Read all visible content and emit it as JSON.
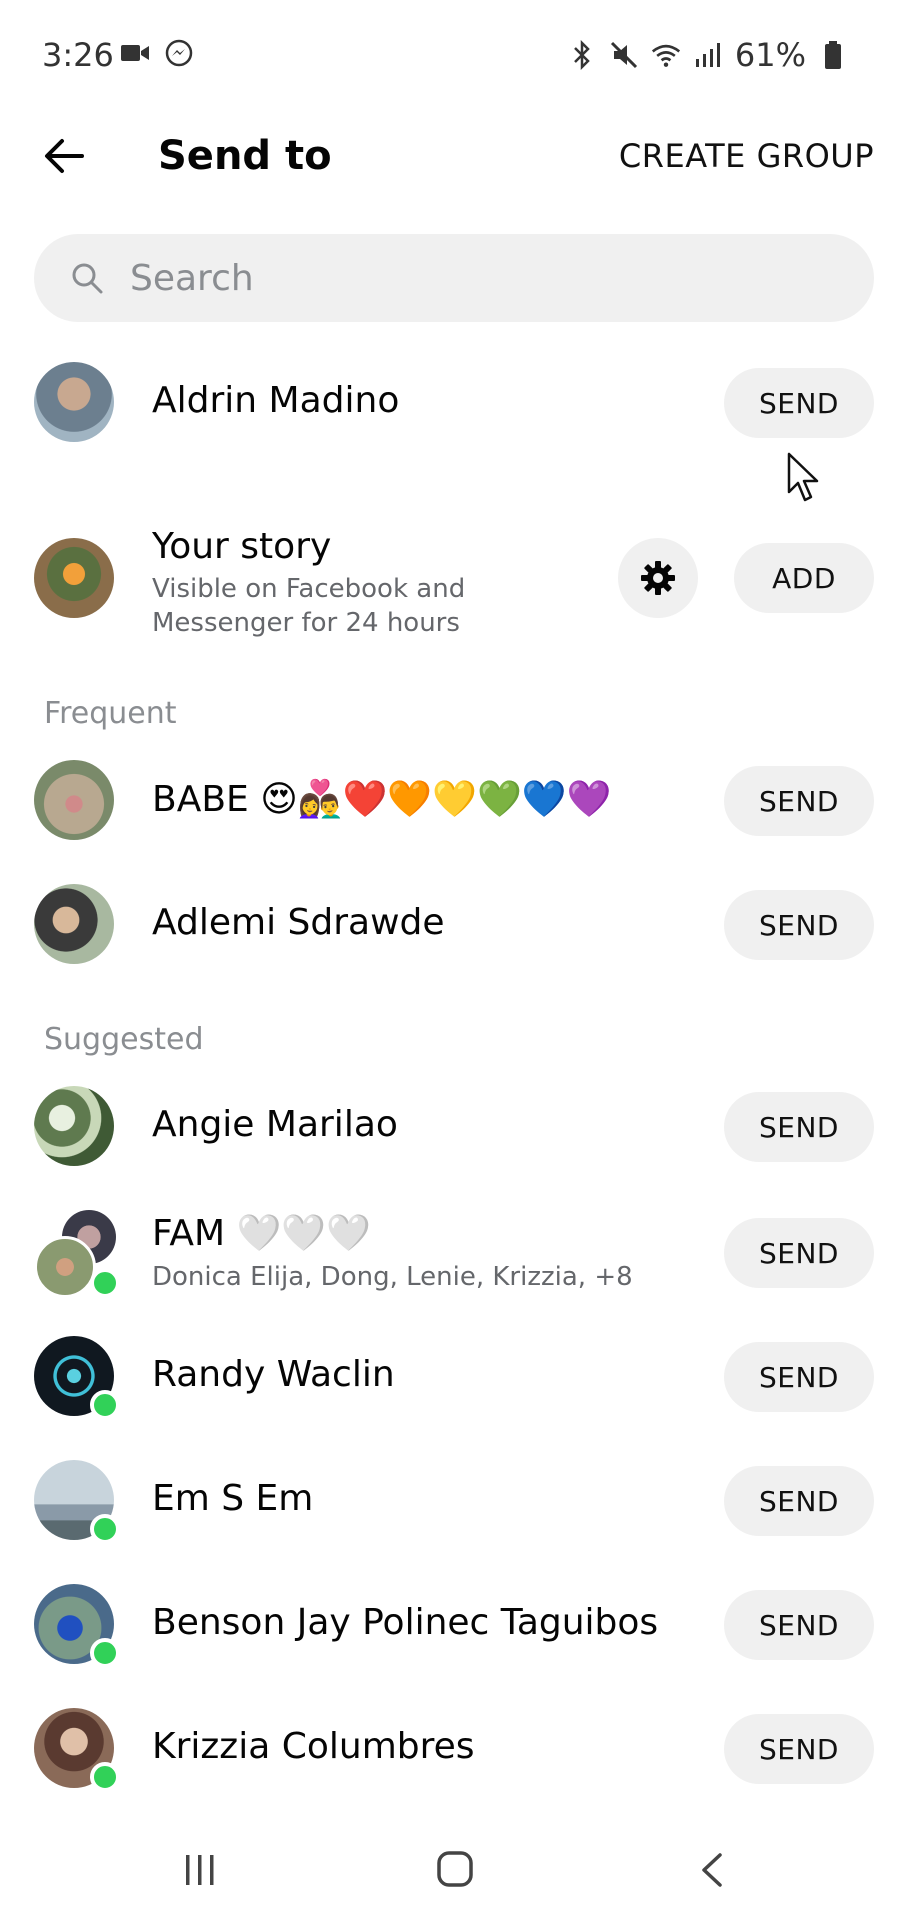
{
  "status_bar": {
    "time": "3:26",
    "battery": "61%"
  },
  "header": {
    "title": "Send to",
    "create_group": "CREATE GROUP"
  },
  "search": {
    "placeholder": "Search"
  },
  "top_rows": [
    {
      "name": "Aldrin Madino",
      "button": "SEND",
      "avatar_color": "#6c7f8f"
    },
    {
      "name": "Your story",
      "subtitle_line1": "Visible on Facebook and",
      "subtitle_line2": "Messenger for 24 hours",
      "button": "ADD",
      "avatar_color": "#8a6d4a"
    }
  ],
  "sections": {
    "frequent": "Frequent",
    "suggested": "Suggested"
  },
  "frequent": [
    {
      "name": "BABE",
      "emoji": "😍👩‍❤️‍👨❤️🧡💛💚💙💜",
      "button": "SEND",
      "avatar_color": "#9a8a70"
    },
    {
      "name": "Adlemi Sdrawde",
      "button": "SEND",
      "avatar_color": "#5a6a60"
    }
  ],
  "suggested": [
    {
      "name": "Angie Marilao",
      "button": "SEND",
      "avatar_color": "#5f7a4f",
      "online": false
    },
    {
      "name": "FAM",
      "emoji": "🤍🤍🤍",
      "subtitle": "Donica Elija, Dong, Lenie, Krizzia, +8",
      "button": "SEND",
      "avatar_color": "#7a6a58",
      "online": true
    },
    {
      "name": "Randy Waclin",
      "button": "SEND",
      "avatar_color": "#101820",
      "online": true
    },
    {
      "name": "Em S Em",
      "button": "SEND",
      "avatar_color": "#8a9aa8",
      "online": true
    },
    {
      "name": "Benson Jay Polinec Taguibos",
      "button": "SEND",
      "avatar_color": "#4a6a8a",
      "online": true
    },
    {
      "name": "Krizzia Columbres",
      "button": "SEND",
      "avatar_color": "#8a6a58",
      "online": true
    }
  ]
}
